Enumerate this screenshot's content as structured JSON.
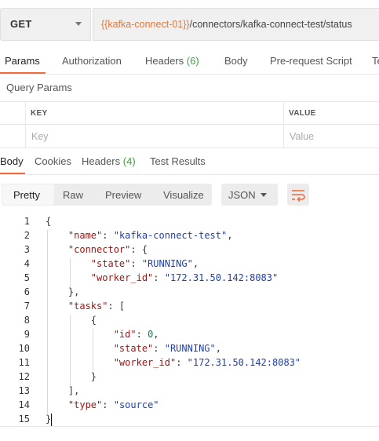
{
  "request": {
    "method": "GET",
    "url_variable": "{{kafka-connect-01}}",
    "url_path": "/connectors/kafka-connect-test/status"
  },
  "request_tabs": [
    {
      "label": "Params",
      "count": "",
      "active": true
    },
    {
      "label": "Authorization",
      "count": "",
      "active": false
    },
    {
      "label": "Headers",
      "count": "(6)",
      "active": false
    },
    {
      "label": "Body",
      "count": "",
      "active": false
    },
    {
      "label": "Pre-request Script",
      "count": "",
      "active": false
    },
    {
      "label": "Te",
      "count": "",
      "active": false
    }
  ],
  "query_params": {
    "title": "Query Params",
    "col_key": "KEY",
    "col_value": "VALUE",
    "key_placeholder": "Key",
    "value_placeholder": "Value"
  },
  "response_tabs": [
    {
      "label": "Body",
      "count": "",
      "active": true
    },
    {
      "label": "Cookies",
      "count": "",
      "active": false
    },
    {
      "label": "Headers",
      "count": "(4)",
      "active": false
    },
    {
      "label": "Test Results",
      "count": "",
      "active": false
    }
  ],
  "view_modes": [
    "Pretty",
    "Raw",
    "Preview",
    "Visualize"
  ],
  "format": "JSON",
  "icons": {
    "method_caret": "chevron-down-icon",
    "format_caret": "chevron-down-icon",
    "wrap": "wrap-lines-icon"
  },
  "colors": {
    "accent": "#f26b3a",
    "count": "#3ea33e",
    "variable": "#e2773a",
    "json_key": "#a31515",
    "json_string": "#1f3fb0",
    "json_number": "#098658"
  },
  "code_lines": [
    {
      "n": "1",
      "t": [
        [
          "p",
          "{"
        ]
      ]
    },
    {
      "n": "2",
      "t": [
        [
          "p",
          "    "
        ],
        [
          "k",
          "\"name\""
        ],
        [
          "p",
          ": "
        ],
        [
          "s",
          "\"kafka-connect-test\""
        ],
        [
          "p",
          ","
        ]
      ]
    },
    {
      "n": "3",
      "t": [
        [
          "p",
          "    "
        ],
        [
          "k",
          "\"connector\""
        ],
        [
          "p",
          ": {"
        ]
      ]
    },
    {
      "n": "4",
      "t": [
        [
          "p",
          "        "
        ],
        [
          "k",
          "\"state\""
        ],
        [
          "p",
          ": "
        ],
        [
          "s",
          "\"RUNNING\""
        ],
        [
          "p",
          ","
        ]
      ]
    },
    {
      "n": "5",
      "t": [
        [
          "p",
          "        "
        ],
        [
          "k",
          "\"worker_id\""
        ],
        [
          "p",
          ": "
        ],
        [
          "s",
          "\"172.31.50.142:8083\""
        ]
      ]
    },
    {
      "n": "6",
      "t": [
        [
          "p",
          "    },"
        ]
      ]
    },
    {
      "n": "7",
      "t": [
        [
          "p",
          "    "
        ],
        [
          "k",
          "\"tasks\""
        ],
        [
          "p",
          ": ["
        ]
      ]
    },
    {
      "n": "8",
      "t": [
        [
          "p",
          "        {"
        ]
      ]
    },
    {
      "n": "9",
      "t": [
        [
          "p",
          "            "
        ],
        [
          "k",
          "\"id\""
        ],
        [
          "p",
          ": "
        ],
        [
          "n",
          "0"
        ],
        [
          "p",
          ","
        ]
      ]
    },
    {
      "n": "10",
      "t": [
        [
          "p",
          "            "
        ],
        [
          "k",
          "\"state\""
        ],
        [
          "p",
          ": "
        ],
        [
          "s",
          "\"RUNNING\""
        ],
        [
          "p",
          ","
        ]
      ]
    },
    {
      "n": "11",
      "t": [
        [
          "p",
          "            "
        ],
        [
          "k",
          "\"worker_id\""
        ],
        [
          "p",
          ": "
        ],
        [
          "s",
          "\"172.31.50.142:8083\""
        ]
      ]
    },
    {
      "n": "12",
      "t": [
        [
          "p",
          "        }"
        ]
      ]
    },
    {
      "n": "13",
      "t": [
        [
          "p",
          "    ],"
        ]
      ]
    },
    {
      "n": "14",
      "t": [
        [
          "p",
          "    "
        ],
        [
          "k",
          "\"type\""
        ],
        [
          "p",
          ": "
        ],
        [
          "s",
          "\"source\""
        ]
      ]
    },
    {
      "n": "15",
      "t": [
        [
          "p",
          "}"
        ]
      ]
    }
  ]
}
